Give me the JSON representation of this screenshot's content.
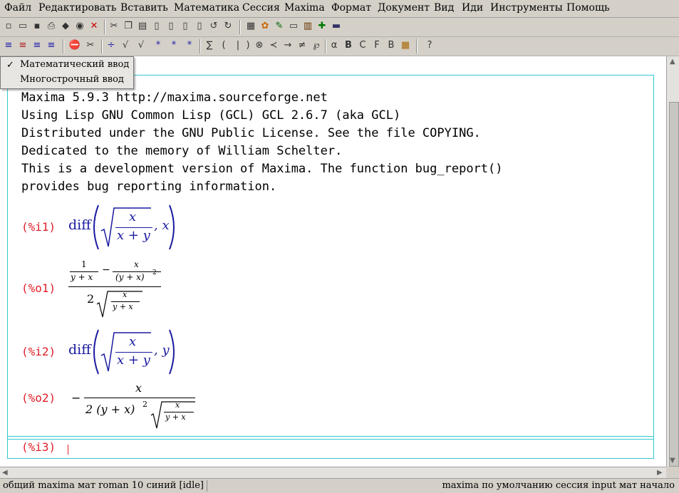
{
  "menu": [
    "Файл",
    "Редактировать",
    "Вставить",
    "Математика",
    "Сессия",
    "Maxima",
    "Формат",
    "Документ",
    "Вид",
    "Иди",
    "Инструменты",
    "Помощь"
  ],
  "popup": {
    "items": [
      "Математический ввод",
      "Многострочный ввод"
    ],
    "checked_index": 0,
    "check_mark": "✓"
  },
  "banner": [
    "Maxima 5.9.3 http://maxima.sourceforge.net",
    "Using Lisp GNU Common Lisp (GCL) GCL 2.6.7 (aka GCL)",
    "Distributed under the GNU Public License. See the file COPYING.",
    "Dedicated to the memory of William Schelter.",
    "This is a development version of Maxima. The function bug_report()",
    "provides bug reporting information."
  ],
  "cells": {
    "i1_label": "(%i1)",
    "o1_label": "(%o1)",
    "i2_label": "(%i2)",
    "o2_label": "(%o2)",
    "i3_label": "(%i3)",
    "diff": "diff",
    "x": "x",
    "y": "y",
    "x_plus_y": "x + y",
    "y_plus_x": "y + x",
    "one": "1",
    "minus": "−",
    "comma_x": ", x",
    "comma_y": ", y",
    "y_plus_x_sq": "(y + x)",
    "sq": "2",
    "two": "2",
    "o2_den": "2 (y + x)"
  },
  "status": {
    "left": "общий maxima мат roman 10 синий [idle]",
    "right": "maxima по умолчанию сессия input мат начало"
  },
  "colors": {
    "prompt": "#e0202a",
    "math_input": "#1a1aa0",
    "cell_frame": "#33c8d4"
  }
}
